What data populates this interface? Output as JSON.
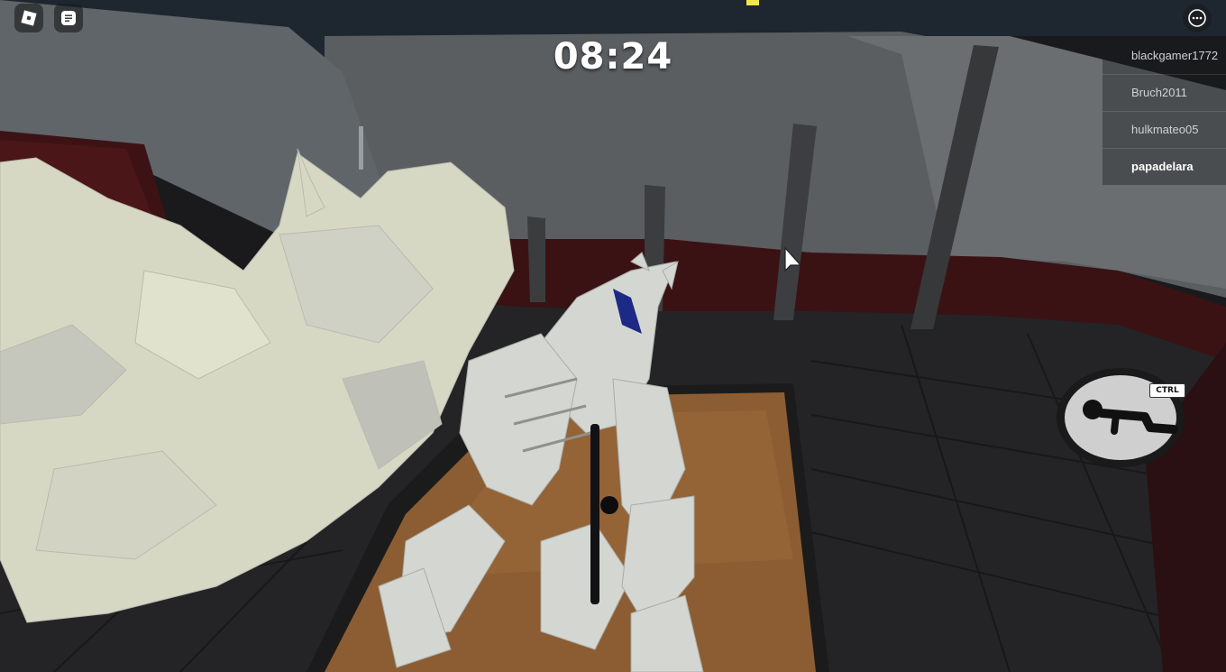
{
  "hud": {
    "timer": "08:24",
    "crawl_key_hint": "CTRL"
  },
  "player_list": {
    "players": [
      {
        "name": "blackgamer1772",
        "is_local": false
      },
      {
        "name": "Bruch2011",
        "is_local": false
      },
      {
        "name": "hulkmateo05",
        "is_local": false
      },
      {
        "name": "papadelara",
        "is_local": true
      }
    ]
  },
  "icons": {
    "menu": "roblox-logo-icon",
    "chat": "chat-icon",
    "more": "more-options-icon",
    "crawl": "crawl-icon"
  },
  "colors": {
    "walls": "#5d6164",
    "ceiling": "#1f262c",
    "floor": "#252527",
    "wall_trim": "#3d1416",
    "sand_pit": "#8a5c33",
    "skeleton": "#d8dac9"
  }
}
